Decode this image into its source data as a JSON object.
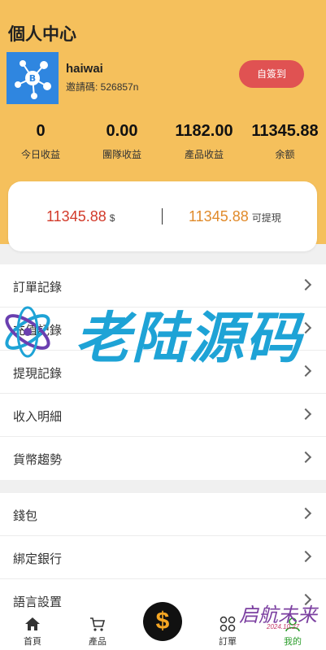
{
  "header": {
    "title": "個人中心",
    "username": "haiwai",
    "invite_code": "邀請碼: 526857n",
    "signin_label": "自簽到",
    "background_color": "#f5c05c"
  },
  "stats": [
    {
      "value": "0",
      "label": "今日收益"
    },
    {
      "value": "0.00",
      "label": "團隊收益"
    },
    {
      "value": "1182.00",
      "label": "產品收益"
    },
    {
      "value": "11345.88",
      "label": "余额"
    }
  ],
  "balance": {
    "left_value": "11345.88",
    "left_suffix": "$",
    "right_value": "11345.88",
    "right_suffix": "可提現"
  },
  "menu_group_1": [
    {
      "label": "訂單記錄"
    },
    {
      "label": "充值記錄"
    },
    {
      "label": "提現記錄"
    },
    {
      "label": "收入明細"
    },
    {
      "label": "貨幣趨勢"
    }
  ],
  "menu_group_2": [
    {
      "label": "錢包"
    },
    {
      "label": "綁定銀行"
    },
    {
      "label": "語言設置"
    }
  ],
  "watermark": {
    "text": "老陆源码"
  },
  "tabbar": {
    "home": "首頁",
    "products": "產品",
    "center_icon": "$",
    "orders": "訂單",
    "mine": "我的",
    "active_color": "#2a9d2a"
  },
  "signature": {
    "text": "启航未来",
    "date": "2024.10.27"
  }
}
